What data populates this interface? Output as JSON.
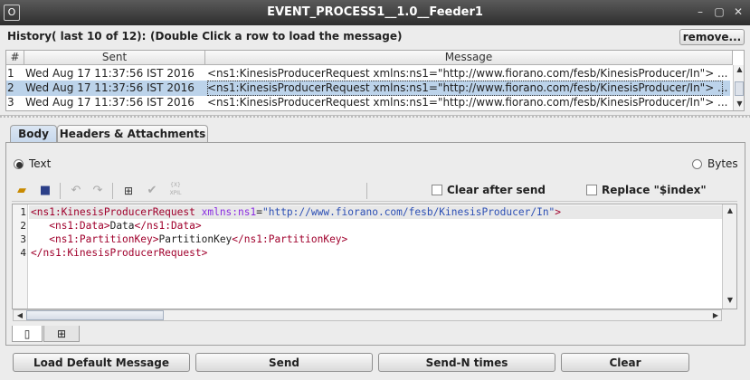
{
  "window": {
    "title": "EVENT_PROCESS1__1.0__Feeder1",
    "app_icon": "o-icon"
  },
  "history": {
    "label": "History( last 10 of 12):",
    "hint": "(Double Click a row to load the message)",
    "remove_label": "remove...",
    "columns": [
      "#",
      "Sent",
      "Message"
    ],
    "rows": [
      {
        "num": "1",
        "sent": "Wed Aug 17 11:37:56 IST 2016",
        "message": "<ns1:KinesisProducerRequest xmlns:ns1=\"http://www.fiorano.com/fesb/KinesisProducer/In\">",
        "more": "...",
        "selected": false
      },
      {
        "num": "2",
        "sent": "Wed Aug 17 11:37:56 IST 2016",
        "message": "<ns1:KinesisProducerRequest xmlns:ns1=\"http://www.fiorano.com/fesb/KinesisProducer/In\">",
        "more": "...",
        "selected": true
      },
      {
        "num": "3",
        "sent": "Wed Aug 17 11:37:56 IST 2016",
        "message": "<ns1:KinesisProducerRequest xmlns:ns1=\"http://www.fiorano.com/fesb/KinesisProducer/In\">",
        "more": "...",
        "selected": false
      }
    ]
  },
  "tabs": [
    {
      "label": "Body",
      "active": true
    },
    {
      "label": "Headers & Attachments",
      "active": false
    }
  ],
  "format": {
    "text_label": "Text",
    "bytes_label": "Bytes",
    "selected": "Text"
  },
  "toolbar": {
    "clear_after_send": "Clear after send",
    "replace_index": "Replace \"$index\"",
    "icons": [
      "open-folder-icon",
      "save-icon",
      "undo-icon",
      "redo-icon",
      "tree-view-icon",
      "validate-check-icon",
      "xpath-icon"
    ],
    "xpath_icon_text": "{X}\nXPIL"
  },
  "editor": {
    "line_numbers": [
      "1",
      "2",
      "3",
      "4"
    ],
    "lines": [
      {
        "parts": [
          {
            "cls": "tag",
            "t": "<ns1:KinesisProducerRequest"
          },
          {
            "cls": "txt",
            "t": " "
          },
          {
            "cls": "attr",
            "t": "xmlns:ns1"
          },
          {
            "cls": "txt",
            "t": "="
          },
          {
            "cls": "val",
            "t": "\"http://www.fiorano.com/fesb/KinesisProducer/In\""
          },
          {
            "cls": "tag",
            "t": ">"
          }
        ]
      },
      {
        "parts": [
          {
            "cls": "txt",
            "t": "   "
          },
          {
            "cls": "tag",
            "t": "<ns1:Data>"
          },
          {
            "cls": "txt",
            "t": "Data"
          },
          {
            "cls": "tag",
            "t": "</ns1:Data>"
          }
        ]
      },
      {
        "parts": [
          {
            "cls": "txt",
            "t": "   "
          },
          {
            "cls": "tag",
            "t": "<ns1:PartitionKey>"
          },
          {
            "cls": "txt",
            "t": "PartitionKey"
          },
          {
            "cls": "tag",
            "t": "</ns1:PartitionKey>"
          }
        ]
      },
      {
        "parts": [
          {
            "cls": "tag",
            "t": "</ns1:KinesisProducerRequest>"
          }
        ]
      }
    ]
  },
  "view_tabs": [
    {
      "icon": "document-icon",
      "active": true
    },
    {
      "icon": "tree-view-icon",
      "active": false
    }
  ],
  "buttons": {
    "load_default": "Load Default Message",
    "send": "Send",
    "send_n": "Send-N times",
    "clear": "Clear"
  },
  "colors": {
    "selection": "#bcd3ea",
    "tag": "#a0002c",
    "attribute": "#8a2be2",
    "value": "#2c4fb5"
  }
}
